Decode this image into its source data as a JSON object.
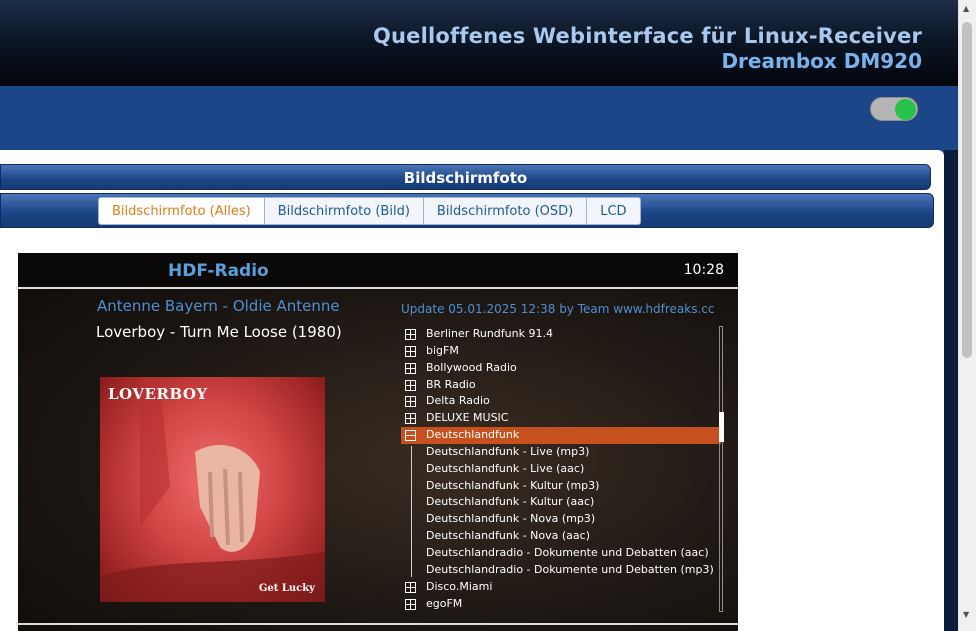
{
  "header": {
    "title": "Quelloffenes Webinterface für Linux-Receiver",
    "device": "Dreambox DM920"
  },
  "nav": {
    "toggle_state": "on"
  },
  "section": {
    "title": "Bildschirmfoto"
  },
  "tabs": [
    {
      "label": "Bildschirmfoto (Alles)",
      "active": true
    },
    {
      "label": "Bildschirmfoto (Bild)",
      "active": false
    },
    {
      "label": "Bildschirmfoto (OSD)",
      "active": false
    },
    {
      "label": "LCD",
      "active": false
    }
  ],
  "screenshot": {
    "app_title": "HDF-Radio",
    "time": "10:28",
    "station": "Antenne Bayern - Oldie Antenne",
    "now_playing": "Loverboy - Turn Me Loose (1980)",
    "cover": {
      "brand": "LOVERBOY",
      "album": "Get Lucky"
    },
    "update_note": "Update 05.01.2025 12:38 by Team www.hdfreaks.cc",
    "list": [
      {
        "label": "Berliner Rundfunk 91.4",
        "type": "group"
      },
      {
        "label": "bigFM",
        "type": "group"
      },
      {
        "label": "Bollywood Radio",
        "type": "group"
      },
      {
        "label": "BR Radio",
        "type": "group"
      },
      {
        "label": "Delta Radio",
        "type": "group"
      },
      {
        "label": "DELUXE MUSIC",
        "type": "group"
      },
      {
        "label": "Deutschlandfunk",
        "type": "group-open",
        "selected": true
      },
      {
        "label": "Deutschlandfunk - Live (mp3)",
        "type": "item"
      },
      {
        "label": "Deutschlandfunk - Live (aac)",
        "type": "item"
      },
      {
        "label": "Deutschlandfunk - Kultur (mp3)",
        "type": "item"
      },
      {
        "label": "Deutschlandfunk - Kultur (aac)",
        "type": "item"
      },
      {
        "label": "Deutschlandfunk - Nova (mp3)",
        "type": "item"
      },
      {
        "label": "Deutschlandfunk - Nova (aac)",
        "type": "item"
      },
      {
        "label": "Deutschlandradio - Dokumente und Debatten (aac)",
        "type": "item"
      },
      {
        "label": "Deutschlandradio - Dokumente und Debatten (mp3)",
        "type": "item"
      },
      {
        "label": "Disco.Miami",
        "type": "group"
      },
      {
        "label": "egoFM",
        "type": "group"
      }
    ]
  },
  "colors": {
    "nav_blue": "#1c4687",
    "active_tab_text": "#e07b17",
    "selection": "#c6511f",
    "toggle_on": "#26c249"
  }
}
